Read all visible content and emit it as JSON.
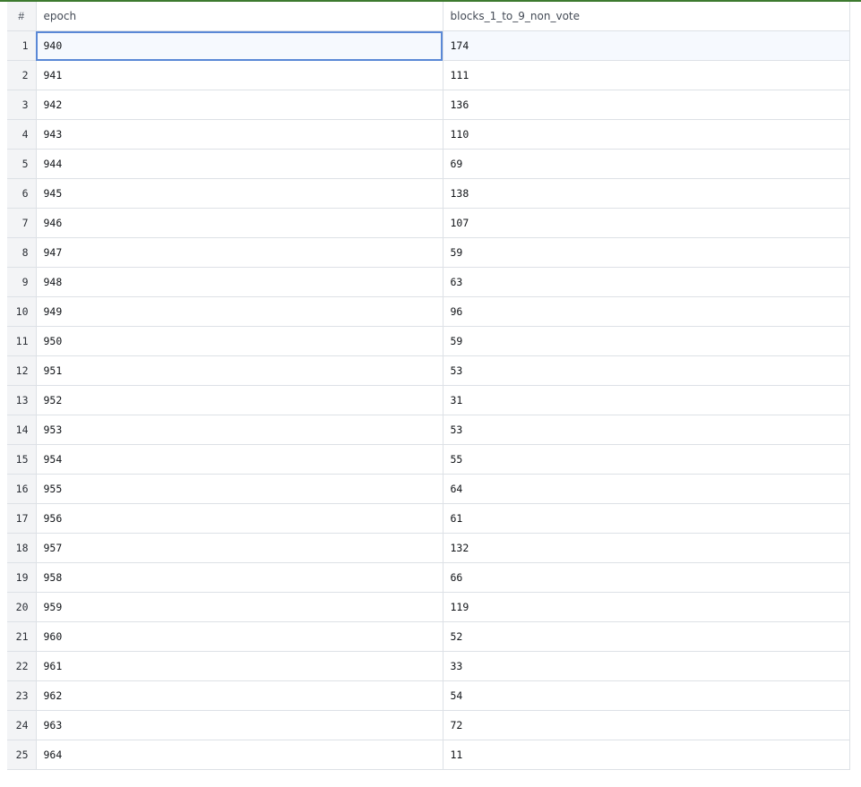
{
  "table": {
    "columns": {
      "index": "#",
      "epoch": "epoch",
      "blocks": "blocks_1_to_9_non_vote"
    },
    "rows": [
      {
        "n": "1",
        "epoch": "940",
        "blocks": "174"
      },
      {
        "n": "2",
        "epoch": "941",
        "blocks": "111"
      },
      {
        "n": "3",
        "epoch": "942",
        "blocks": "136"
      },
      {
        "n": "4",
        "epoch": "943",
        "blocks": "110"
      },
      {
        "n": "5",
        "epoch": "944",
        "blocks": "69"
      },
      {
        "n": "6",
        "epoch": "945",
        "blocks": "138"
      },
      {
        "n": "7",
        "epoch": "946",
        "blocks": "107"
      },
      {
        "n": "8",
        "epoch": "947",
        "blocks": "59"
      },
      {
        "n": "9",
        "epoch": "948",
        "blocks": "63"
      },
      {
        "n": "10",
        "epoch": "949",
        "blocks": "96"
      },
      {
        "n": "11",
        "epoch": "950",
        "blocks": "59"
      },
      {
        "n": "12",
        "epoch": "951",
        "blocks": "53"
      },
      {
        "n": "13",
        "epoch": "952",
        "blocks": "31"
      },
      {
        "n": "14",
        "epoch": "953",
        "blocks": "53"
      },
      {
        "n": "15",
        "epoch": "954",
        "blocks": "55"
      },
      {
        "n": "16",
        "epoch": "955",
        "blocks": "64"
      },
      {
        "n": "17",
        "epoch": "956",
        "blocks": "61"
      },
      {
        "n": "18",
        "epoch": "957",
        "blocks": "132"
      },
      {
        "n": "19",
        "epoch": "958",
        "blocks": "66"
      },
      {
        "n": "20",
        "epoch": "959",
        "blocks": "119"
      },
      {
        "n": "21",
        "epoch": "960",
        "blocks": "52"
      },
      {
        "n": "22",
        "epoch": "961",
        "blocks": "33"
      },
      {
        "n": "23",
        "epoch": "962",
        "blocks": "54"
      },
      {
        "n": "24",
        "epoch": "963",
        "blocks": "72"
      },
      {
        "n": "25",
        "epoch": "964",
        "blocks": "11"
      }
    ]
  }
}
